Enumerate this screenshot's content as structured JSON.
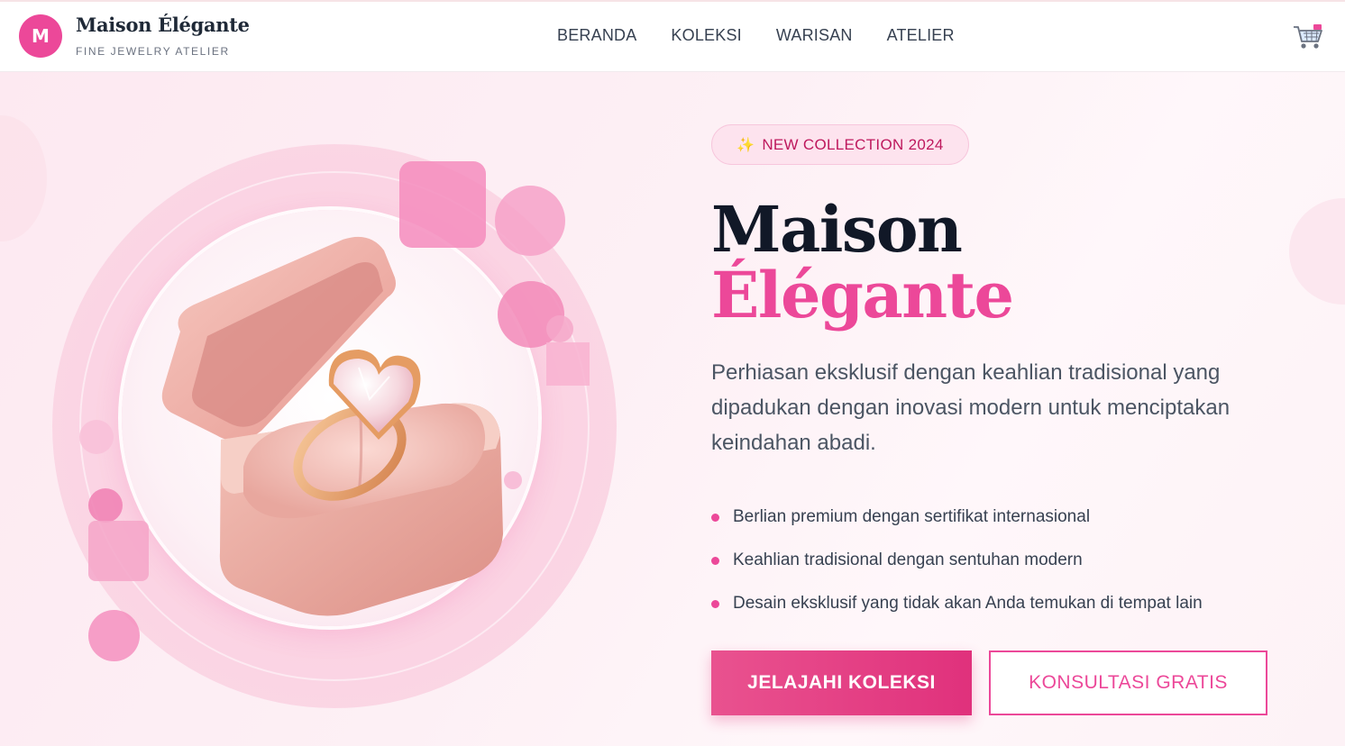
{
  "brand": {
    "logo_letter": "M",
    "name": "Maison Élégante",
    "tagline": "FINE JEWELRY ATELIER"
  },
  "nav": {
    "items": [
      {
        "label": "BERANDA"
      },
      {
        "label": "KOLEKSI"
      },
      {
        "label": "WARISAN"
      },
      {
        "label": "ATELIER"
      }
    ]
  },
  "header": {
    "cart_icon": "shopping-cart-icon"
  },
  "hero": {
    "badge": {
      "icon": "sparkles-icon",
      "text": "NEW COLLECTION 2024"
    },
    "title_line1": "Maison",
    "title_line2": "Élégante",
    "description": "Perhiasan eksklusif dengan keahlian tradisional yang dipadukan dengan inovasi modern untuk menciptakan keindahan abadi.",
    "features": [
      "Berlian premium dengan sertifikat internasional",
      "Keahlian tradisional dengan sentuhan modern",
      "Desain eksklusif yang tidak akan Anda temukan di tempat lain"
    ],
    "primary_cta": "JELAJAHI KOLEKSI",
    "secondary_cta": "KONSULTASI GRATIS",
    "image_subject": "ring-box-icon"
  },
  "colors": {
    "accent": "#ec4899",
    "accent_dark": "#be185d",
    "text_dark": "#111827",
    "body_text": "#4b5563"
  }
}
